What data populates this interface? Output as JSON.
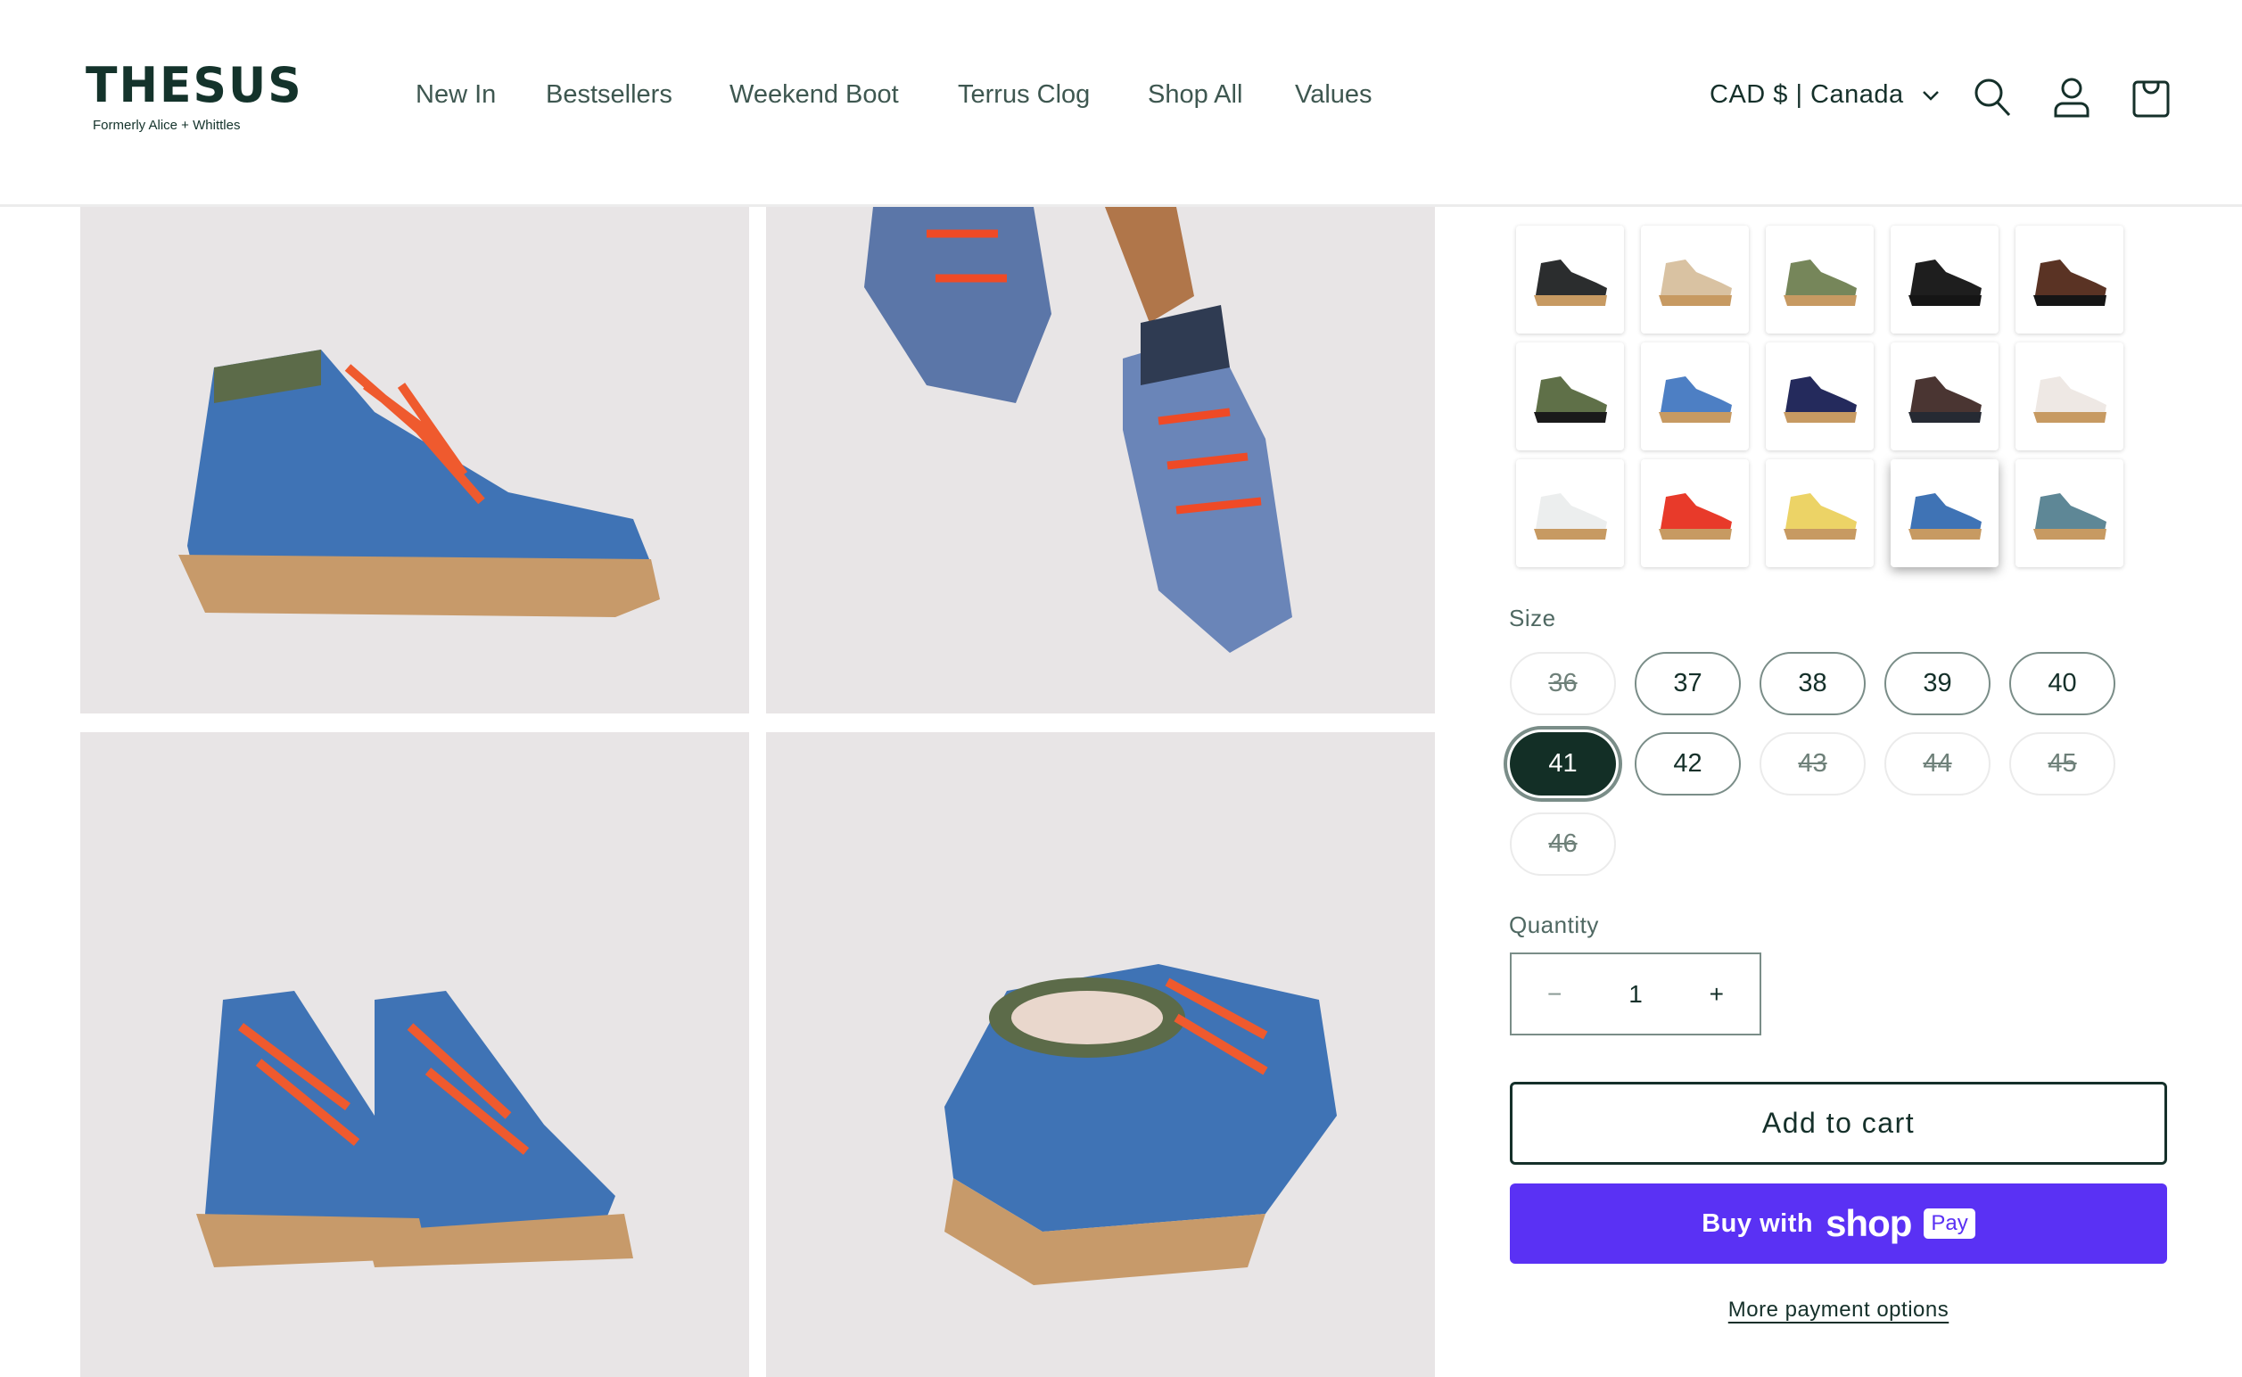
{
  "header": {
    "logo": "THESUS",
    "logo_subtitle": "Formerly Alice + Whittles",
    "nav": [
      "New In",
      "Bestsellers",
      "Weekend Boot",
      "Terrus Clog",
      "Shop All",
      "Values"
    ],
    "currency": "CAD $ | Canada",
    "icons": [
      "search-icon",
      "account-icon",
      "cart-icon"
    ]
  },
  "colors": {
    "brand": "#15302a",
    "shop_pay": "#5a31f4",
    "selected_size": "#132f26"
  },
  "swatches": [
    {
      "upper": "#2b2d2e",
      "sole": "#c79a62",
      "selected": false
    },
    {
      "upper": "#d9c2a2",
      "sole": "#c79a62",
      "selected": false
    },
    {
      "upper": "#76865a",
      "sole": "#c79a62",
      "selected": false
    },
    {
      "upper": "#1e1e1e",
      "sole": "#151515",
      "selected": false
    },
    {
      "upper": "#5a3324",
      "sole": "#151515",
      "selected": false
    },
    {
      "upper": "#5f7048",
      "sole": "#1a1a1a",
      "selected": false
    },
    {
      "upper": "#4d7fc4",
      "sole": "#c79a62",
      "selected": false
    },
    {
      "upper": "#242a5c",
      "sole": "#c79a62",
      "selected": false
    },
    {
      "upper": "#4a3532",
      "sole": "#262a33",
      "selected": false
    },
    {
      "upper": "#eee8e4",
      "sole": "#c79a62",
      "selected": false
    },
    {
      "upper": "#eceeee",
      "sole": "#c79a62",
      "selected": false
    },
    {
      "upper": "#e83a2a",
      "sole": "#c79a62",
      "selected": false
    },
    {
      "upper": "#ecd366",
      "sole": "#c79a62",
      "selected": false
    },
    {
      "upper": "#3f73b5",
      "sole": "#c79a62",
      "selected": true
    },
    {
      "upper": "#5e8796",
      "sole": "#c79a62",
      "selected": false
    }
  ],
  "size": {
    "label": "Size",
    "options": [
      {
        "value": "36",
        "available": false
      },
      {
        "value": "37",
        "available": true
      },
      {
        "value": "38",
        "available": true
      },
      {
        "value": "39",
        "available": true
      },
      {
        "value": "40",
        "available": true
      },
      {
        "value": "41",
        "available": true,
        "selected": true
      },
      {
        "value": "42",
        "available": true
      },
      {
        "value": "43",
        "available": false
      },
      {
        "value": "44",
        "available": false
      },
      {
        "value": "45",
        "available": false
      },
      {
        "value": "46",
        "available": false
      }
    ]
  },
  "quantity": {
    "label": "Quantity",
    "value": "1",
    "minus": "−",
    "plus": "+"
  },
  "actions": {
    "add_to_cart": "Add to cart",
    "buy_with": "Buy with",
    "shop": "shop",
    "pay": "Pay",
    "more_payment": "More payment options"
  }
}
